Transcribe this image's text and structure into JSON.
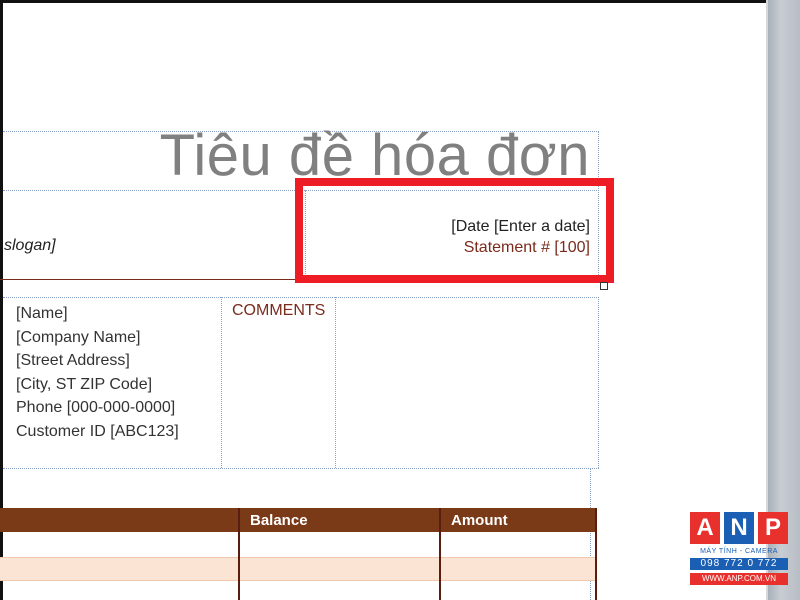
{
  "invoice": {
    "title": "Tiêu đề hóa đơn",
    "slogan": "slogan]",
    "date_line": "[Date [Enter a date]",
    "statement_line": "Statement # [100]",
    "address_lines": [
      "[Name]",
      "[Company Name]",
      "[Street Address]",
      "[City, ST  ZIP Code]",
      "Phone [000-000-0000]",
      "Customer ID [ABC123]"
    ],
    "comments_label": "COMMENTS",
    "table": {
      "headers": [
        "Balance",
        "Amount"
      ]
    }
  },
  "watermark": {
    "letters": [
      "A",
      "N",
      "P"
    ],
    "tagline": "MÁY TÍNH - CAMERA",
    "phone": "098 772 0 772",
    "website": "WWW.ANP.COM.VN"
  },
  "colors": {
    "accent_brown": "#7a3a17",
    "highlight_red": "#ee1c25",
    "row_band": "#fbe4d4",
    "logo_red": "#e8312d",
    "logo_blue": "#1a5fb4"
  }
}
